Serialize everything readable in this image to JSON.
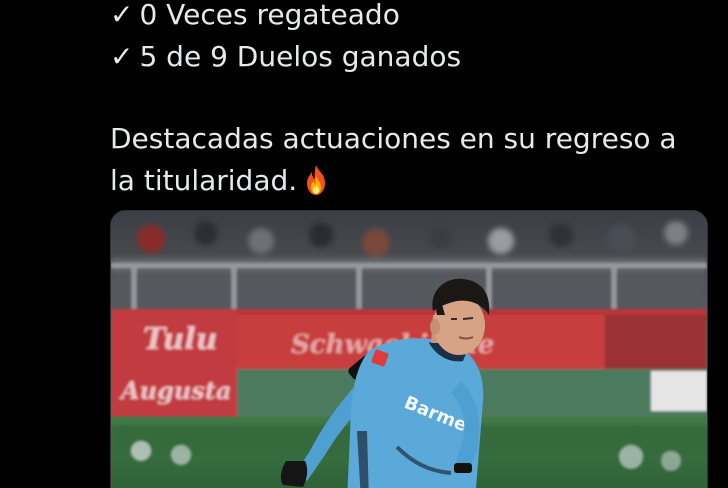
{
  "tweet": {
    "stat_lines": [
      {
        "check": "✓",
        "text": "0 Veces regateado"
      },
      {
        "check": "✓",
        "text": "5 de 9 Duelos ganados"
      }
    ],
    "paragraph_line_1": "Destacadas actuaciones en su regreso a",
    "paragraph_line_2": "la titularidad.",
    "emoji": "fire-icon"
  },
  "media": {
    "type": "photo",
    "jersey_text": "Barmen",
    "colors": {
      "jersey": "#5aa9d8",
      "sleeve": "#4fa0d2",
      "board": "#c73a3a",
      "pitch": "#2f6b3a",
      "text": "#e7e9ea",
      "background": "#000000"
    }
  }
}
